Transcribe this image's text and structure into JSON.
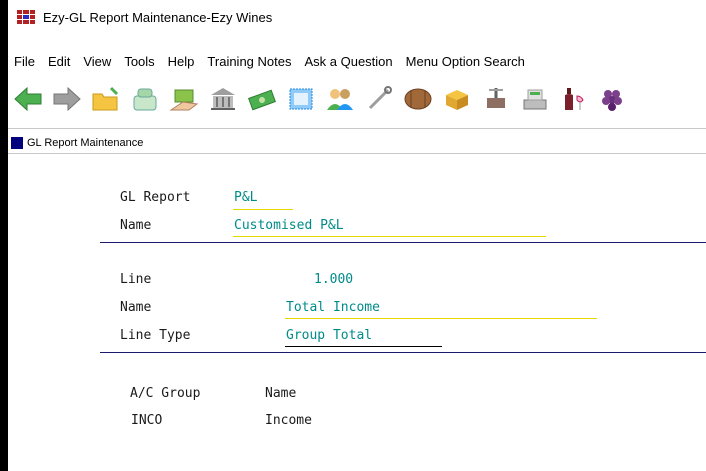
{
  "window": {
    "title": "Ezy-GL Report Maintenance-Ezy Wines"
  },
  "menu": [
    "File",
    "Edit",
    "View",
    "Tools",
    "Help",
    "Training Notes",
    "Ask a Question",
    "Menu Option Search"
  ],
  "toolbar": {
    "icons": [
      "back-arrow-icon",
      "forward-arrow-icon",
      "open-folder-icon",
      "phone-icon",
      "money-hand-icon",
      "bank-building-icon",
      "cash-notes-icon",
      "stamp-icon",
      "people-icon",
      "wrench-icon",
      "barrel-icon",
      "box-icon",
      "wine-press-icon",
      "register-icon",
      "wine-bottle-icon",
      "grapes-icon"
    ]
  },
  "panel": {
    "header": "GL Report Maintenance"
  },
  "report": {
    "gl_report_label": "GL Report",
    "gl_report_value": "P&L",
    "name_label": "Name",
    "name_value": "Customised P&L"
  },
  "line": {
    "line_label": "Line",
    "line_value": "1.000",
    "name_label": "Name",
    "name_value": "Total Income",
    "type_label": "Line Type",
    "type_value": "Group Total"
  },
  "groups": {
    "col_group": "A/C Group",
    "col_name": "Name",
    "rows": [
      {
        "group": "INCO",
        "name": "Income"
      }
    ]
  }
}
